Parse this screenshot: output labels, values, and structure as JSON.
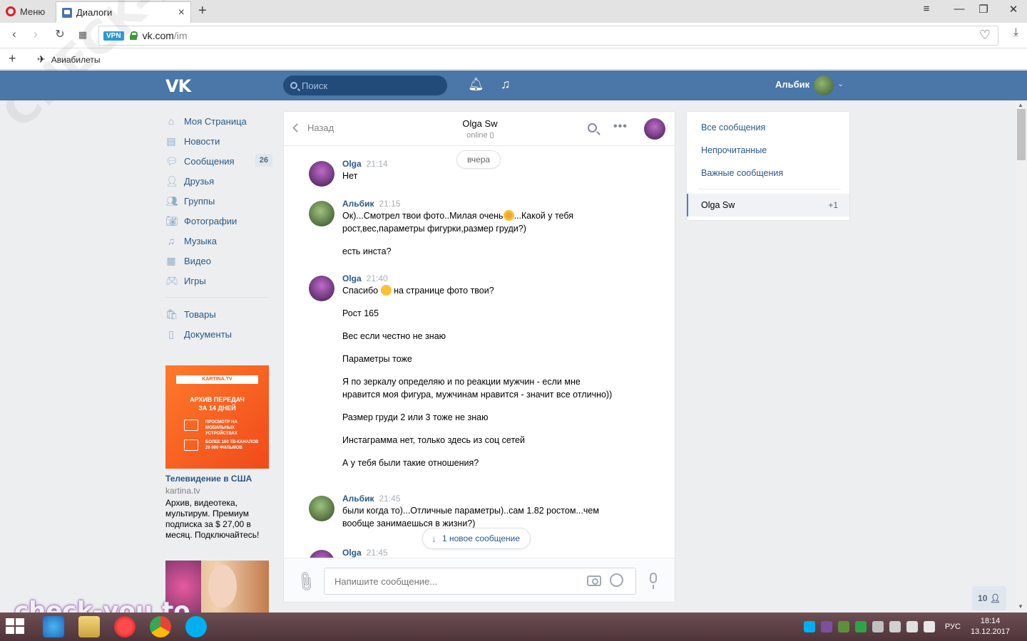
{
  "browser": {
    "menu_label": "Меню",
    "tab_title": "Диалоги",
    "tab_close": "×",
    "new_tab": "+",
    "url_host": "vk.com",
    "url_path": "/im",
    "vpn_label": "VPN",
    "bookmark_label": "Авиабилеты"
  },
  "header": {
    "logo": "VK",
    "search_placeholder": "Поиск",
    "user_name": "Альбик"
  },
  "left_menu": {
    "items": [
      {
        "label": "Моя Страница",
        "icon": "home-icon"
      },
      {
        "label": "Новости",
        "icon": "news-icon"
      },
      {
        "label": "Сообщения",
        "icon": "messages-icon",
        "badge": "26"
      },
      {
        "label": "Друзья",
        "icon": "friends-icon"
      },
      {
        "label": "Группы",
        "icon": "groups-icon"
      },
      {
        "label": "Фотографии",
        "icon": "camera-icon"
      },
      {
        "label": "Музыка",
        "icon": "music-icon"
      },
      {
        "label": "Видео",
        "icon": "video-icon"
      },
      {
        "label": "Игры",
        "icon": "gamepad-icon"
      }
    ],
    "items2": [
      {
        "label": "Товары",
        "icon": "bag-icon"
      },
      {
        "label": "Документы",
        "icon": "document-icon"
      }
    ]
  },
  "ad": {
    "ribbon": "KARTINA.TV",
    "banner_line1": "АРХИВ ПЕРЕДАЧ",
    "banner_line2": "ЗА 14 ДНЕЙ",
    "banner_small1": "ПРОСМОТР НА МОБИЛЬНЫХ УСТРОЙСТВАХ",
    "banner_small2": "БОЛЕЕ 100 ТВ-КАНАЛОВ 20 000 ФИЛЬМОВ",
    "title": "Телевидение в США",
    "domain": "kartina.tv",
    "text": "Архив, видеотека, мультирум. Премиум подписка за $ 27,00 в месяц. Подключайтесь!"
  },
  "chat": {
    "back_label": "Назад",
    "peer_name": "Olga Sw",
    "peer_status": "online",
    "day_label": "вчера",
    "groups": [
      {
        "author": "Olga",
        "time": "21:14",
        "lines": [
          "Нет"
        ]
      },
      {
        "author": "Альбик",
        "time": "21:15",
        "lines": [
          "Ок)...Смотрел твои фото..Милая очень",
          "...Какой у тебя рост,вес,параметры фигурки,размер груди?)",
          "есть инста?"
        ]
      },
      {
        "author": "Olga",
        "time": "21:40",
        "lines": [
          "Спасибо",
          "на странице фото твои?",
          "Рост 165",
          "Вес если честно не знаю",
          "Параметры тоже",
          "Я по зеркалу определяю и по реакции мужчин - если мне нравится моя фигура, мужчинам нравится - значит все отлично))",
          "Размер груди 2 или 3 тоже не знаю",
          "Инстаграмма нет, только здесь из соц сетей",
          "А у тебя были такие отношения?"
        ]
      },
      {
        "author": "Альбик",
        "time": "21:45",
        "lines": [
          "были когда то)...Отличные параметры)..сам 1.82 ростом...чем вообще занимаешься в жизни?)"
        ]
      },
      {
        "author": "Olga",
        "time": "21:45",
        "lines": []
      }
    ],
    "new_message_label": "1 новое сообщение",
    "composer_placeholder": "Напишите сообщение..."
  },
  "right_panel": {
    "all": "Все сообщения",
    "unread": "Непрочитанные",
    "important": "Важные сообщения",
    "active_name": "Olga Sw",
    "active_count": "+1"
  },
  "online_count": "10",
  "watermark": "check-you.to",
  "watermark_diag": "CHECK-YOU.ME",
  "taskbar": {
    "lang": "РУС",
    "time": "18:14",
    "date": "13.12.2017"
  }
}
